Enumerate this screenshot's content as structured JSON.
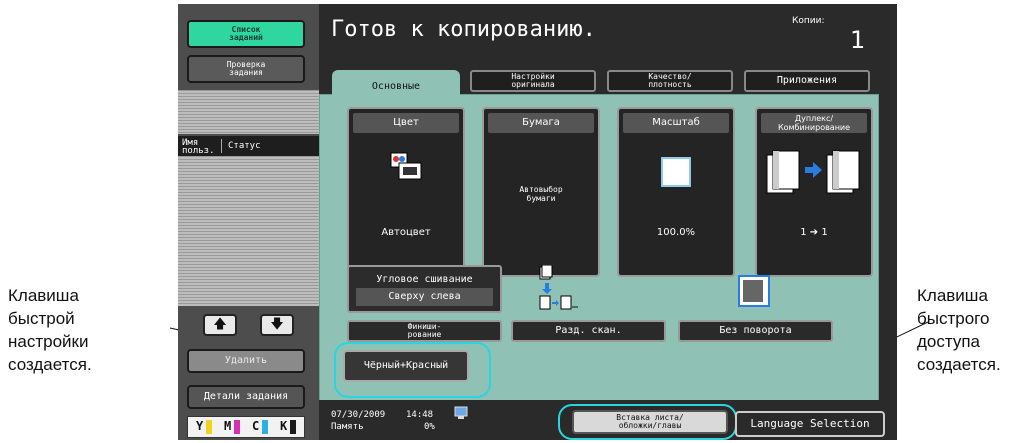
{
  "callouts": {
    "left": [
      "Клавиша",
      "быстрой",
      "настройки",
      "создается."
    ],
    "right": [
      "Клавиша",
      "быстрого",
      "доступа",
      "создается."
    ]
  },
  "sidebar": {
    "job_list": [
      "Список",
      "заданий"
    ],
    "job_check": [
      "Проверка",
      "задания"
    ],
    "user_header": [
      "Имя",
      "польз."
    ],
    "status_header": "Статус",
    "delete": "Удалить",
    "job_details": "Детали задания",
    "toner": [
      "Y",
      "M",
      "C",
      "K"
    ],
    "toner_colors": [
      "#f2d21a",
      "#d62fb0",
      "#2bb0e0",
      "#1a1a1a"
    ]
  },
  "header": {
    "title": "Готов к копированию.",
    "copies_label": "Копии:",
    "copies_value": "1"
  },
  "tabs": [
    {
      "label": [
        "Основные"
      ]
    },
    {
      "label": [
        "Настройки",
        "оригинала"
      ]
    },
    {
      "label": [
        "Качество/",
        "плотность"
      ]
    },
    {
      "label": [
        "Приложения"
      ]
    }
  ],
  "function_keys": {
    "color": {
      "title": "Цвет",
      "value": "Автоцвет"
    },
    "paper": {
      "title": "Бумага",
      "value": [
        "Автовыбор",
        "бумаги"
      ]
    },
    "zoom": {
      "title": "Масштаб",
      "value": "100.0%"
    },
    "duplex": {
      "title": [
        "Дуплекс/",
        "Комбинирование"
      ],
      "value": "1 ➔ 1"
    }
  },
  "options": {
    "corner_staple_label": "Угловое сшивание",
    "corner_staple_value": "Сверху слева",
    "finishing": [
      "Финиши-",
      "рование"
    ],
    "separate_scan": "Разд. скан.",
    "no_rotate": "Без поворота",
    "quick_setting": "Чёрный+Красный"
  },
  "status": {
    "date": "07/30/2009",
    "time": "14:48",
    "memory_label": "Память",
    "memory_value": "0%"
  },
  "bottom_buttons": {
    "insert_sheet": [
      "Вставка листа/",
      "обложки/главы"
    ],
    "language": "Language Selection"
  },
  "colors": {
    "accent_teal": "#2ad4e0",
    "panel_green": "#8fc2b4",
    "list_button": "#2fd6a0"
  }
}
